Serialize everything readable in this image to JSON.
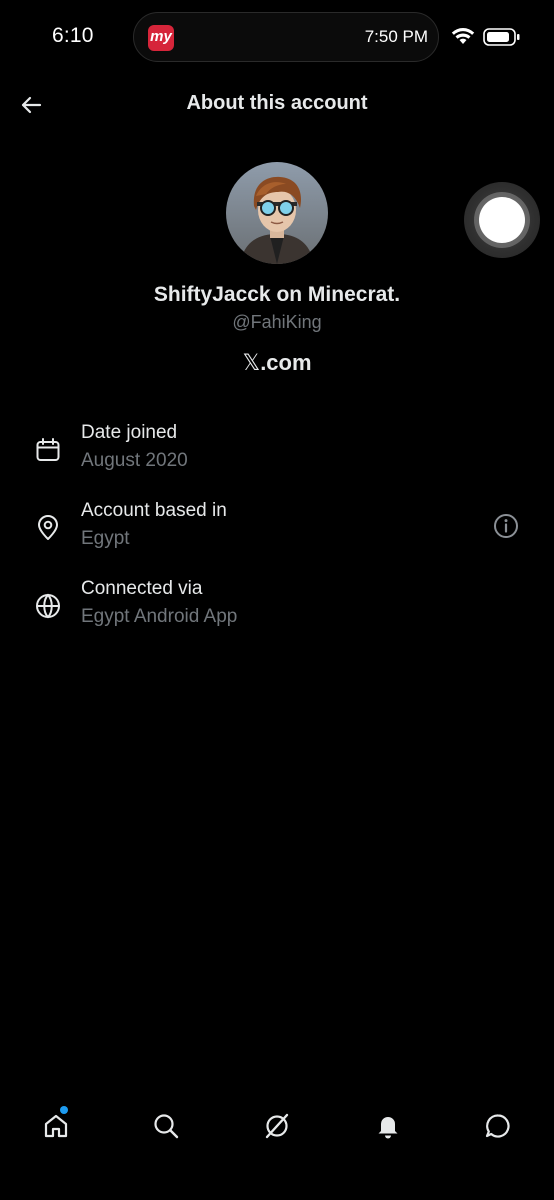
{
  "status_bar": {
    "time": "6:10",
    "app_badge": "my",
    "pill_time": "7:50 PM",
    "icons": [
      "wifi-icon",
      "battery-icon"
    ]
  },
  "header": {
    "title": "About this account",
    "back_icon": "arrow-left-icon"
  },
  "profile": {
    "display_name": "ShiftyJacck on Minecrat.",
    "handle": "@FahiKing",
    "site_mark": "𝕏",
    "site_text": ".com"
  },
  "info_rows": [
    {
      "icon": "calendar-icon",
      "label": "Date joined",
      "value": "August 2020"
    },
    {
      "icon": "location-pin-icon",
      "label": "Account based in",
      "value": "Egypt",
      "trailing_icon": "info-icon"
    },
    {
      "icon": "globe-icon",
      "label": "Connected via",
      "value": "Egypt Android App"
    }
  ],
  "bottom_nav": {
    "items": [
      "home-icon",
      "search-icon",
      "grok-icon",
      "notifications-icon",
      "messages-icon"
    ],
    "home_has_unread": true
  },
  "colors": {
    "background": "#000000",
    "primary_text": "#e7e9ea",
    "secondary_text": "#71767b",
    "accent": "#1d9bf0",
    "badge": "#d6253a"
  }
}
